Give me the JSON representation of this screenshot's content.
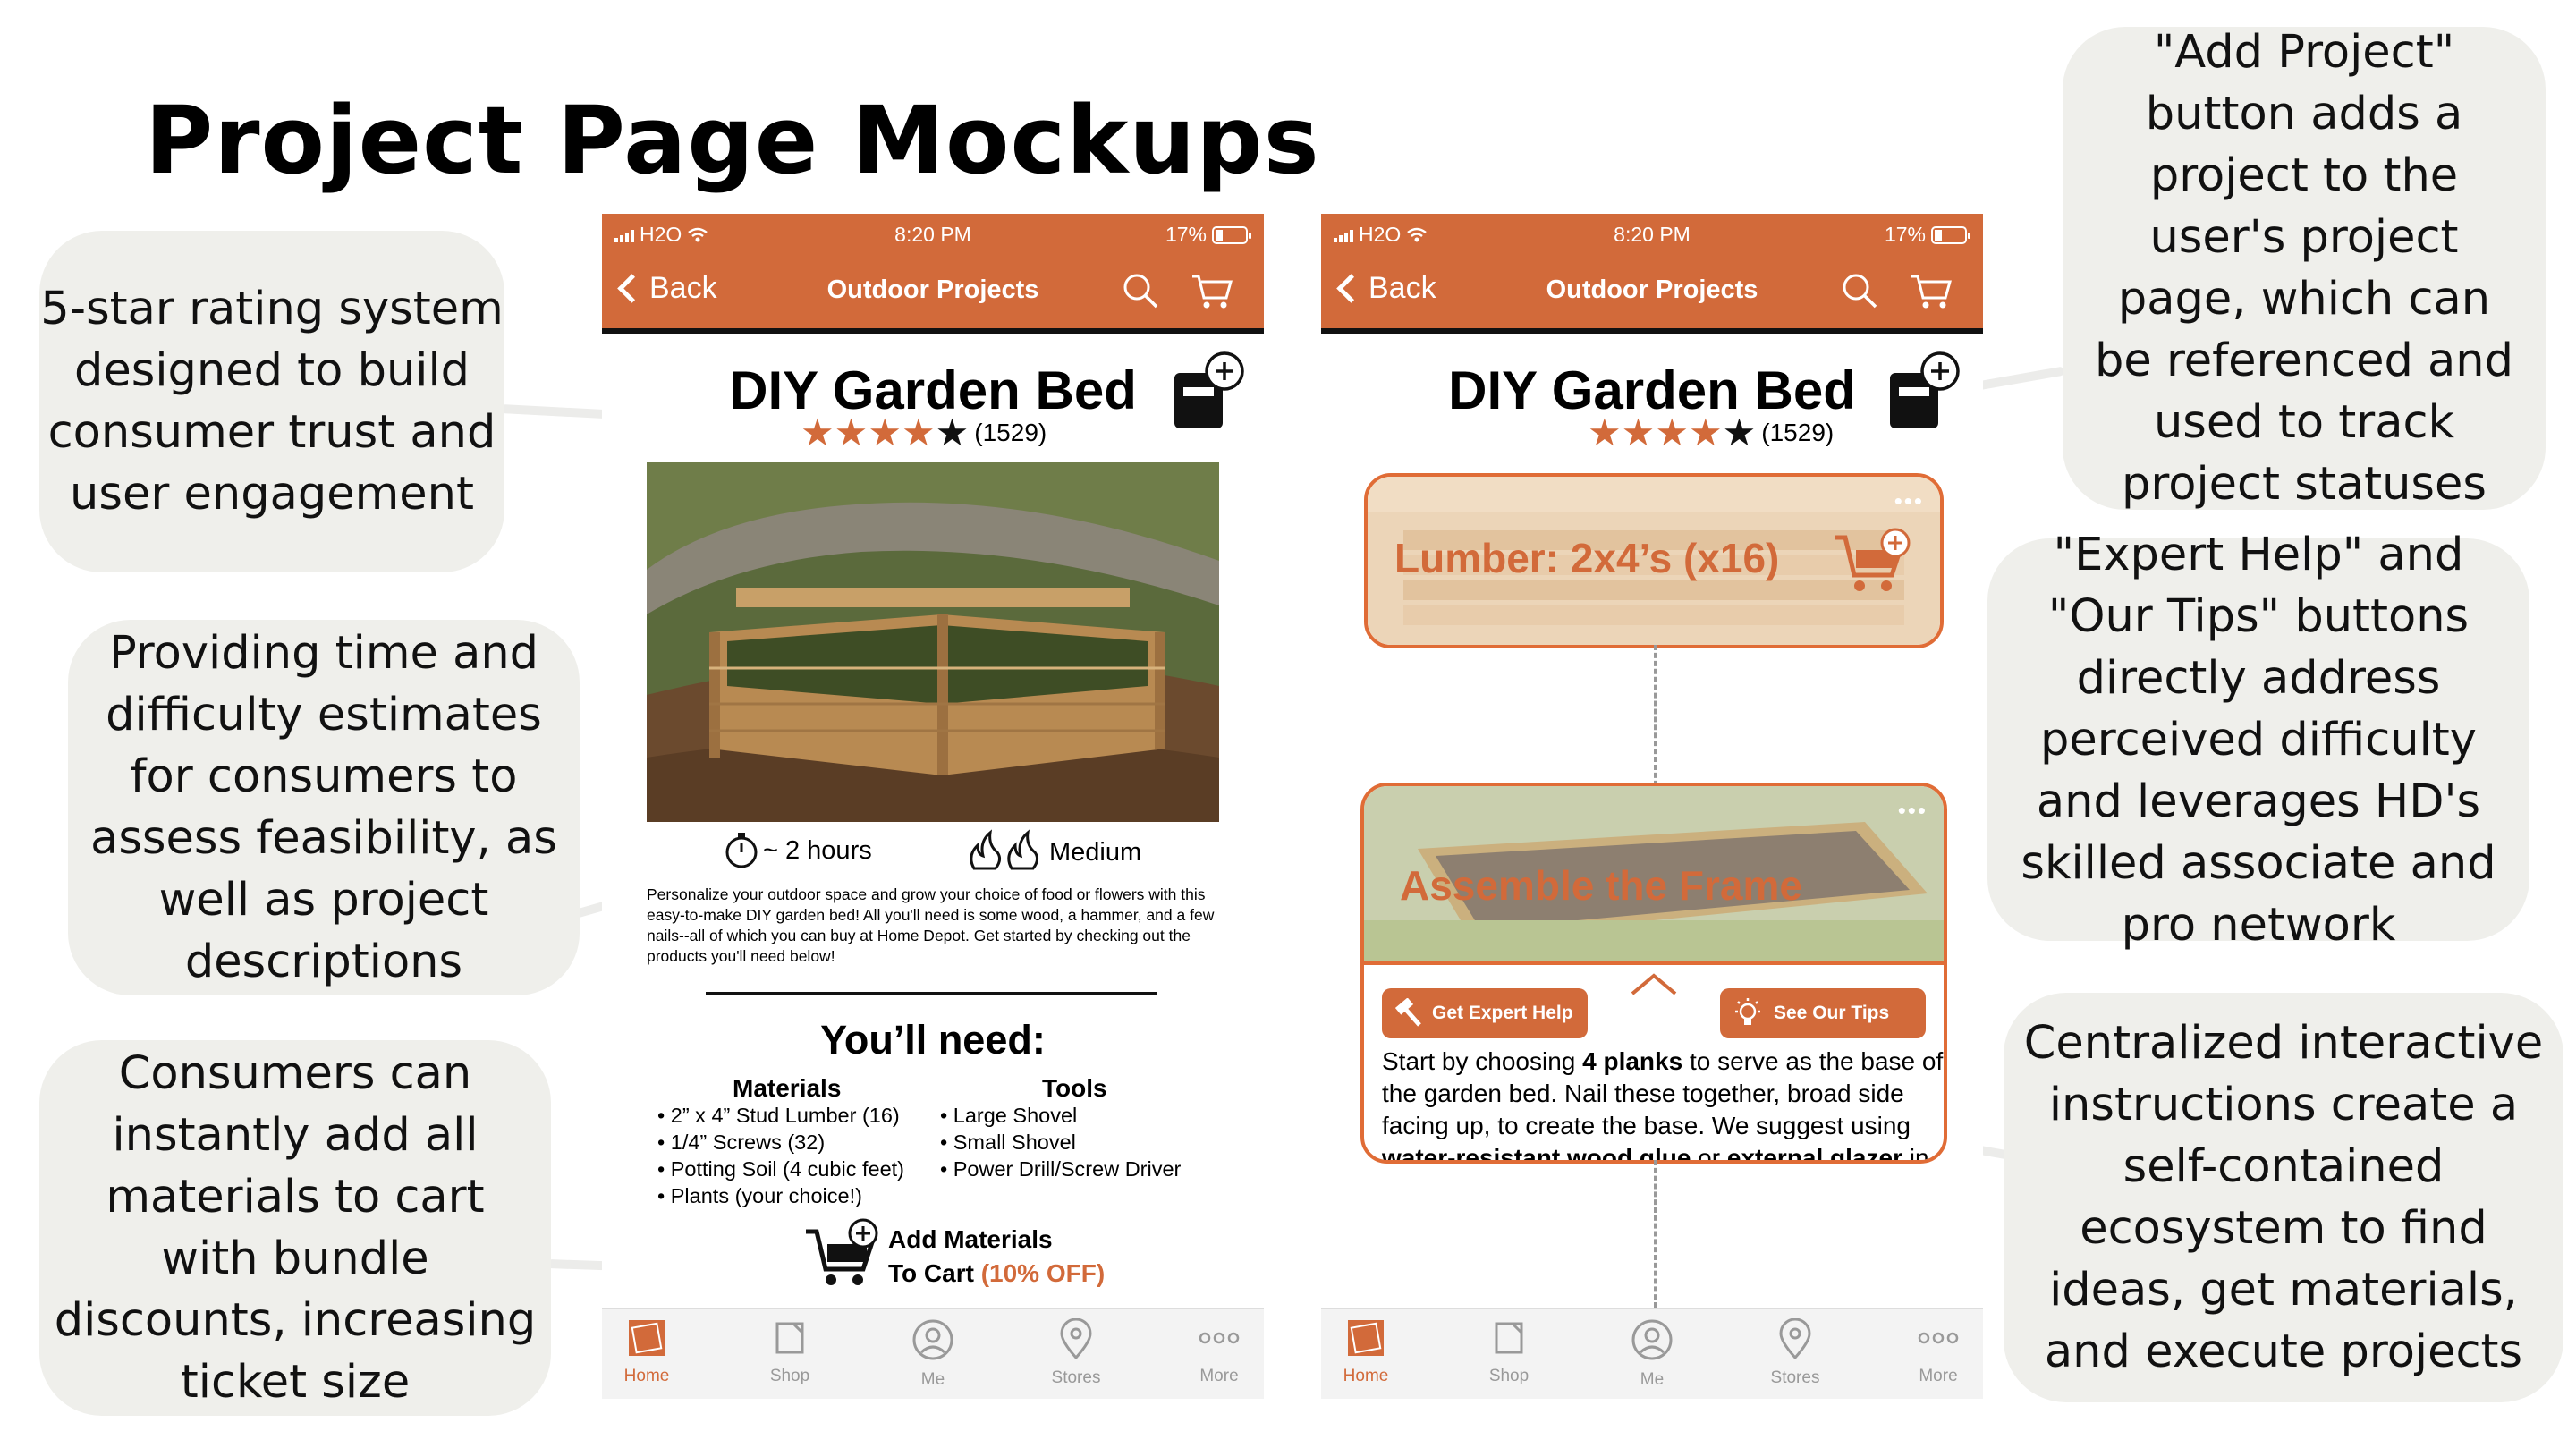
{
  "slide": {
    "title": "Project Page Mockups"
  },
  "callouts": {
    "rating": "5-star rating system designed to build consumer trust and user engagement",
    "estimates": "Providing time and difficulty estimates for consumers to assess feasibility, as well as project descriptions",
    "bundle": "Consumers can instantly add all materials to cart with bundle discounts, increasing ticket size",
    "add_project": "\"Add Project\" button adds a project to the user's project page, which can be referenced and used to track project statuses",
    "expert_help": "\"Expert Help\" and \"Our Tips\" buttons directly address perceived difficulty and leverages HD's skilled associate and pro network",
    "ecosystem": "Centralized interactive instructions create a self-contained ecosystem to find ideas, get materials, and execute projects"
  },
  "status_bar": {
    "carrier": "H2O",
    "time": "8:20 PM",
    "battery": "17%"
  },
  "nav": {
    "back_label": "Back",
    "title": "Outdoor Projects"
  },
  "project": {
    "title": "DIY Garden Bed",
    "rating_count": "(1529)",
    "rating_value": 4,
    "rating_max": 5,
    "time_estimate": "~ 2 hours",
    "difficulty": "Medium",
    "description": "Personalize your outdoor space and grow your choice of food or flowers with this easy-to-make DIY garden bed! All you'll need is some wood, a hammer, and a few nails--all of which you can buy at Home Depot. Get started by checking out the products you'll need below!",
    "youll_need": "You’ll need:",
    "materials_heading": "Materials",
    "tools_heading": "Tools",
    "materials": [
      "• 2” x 4” Stud Lumber (16)",
      "• 1/4” Screws (32)",
      "• Potting Soil (4 cubic feet)",
      "• Plants (your choice!)"
    ],
    "tools": [
      "• Large Shovel",
      "• Small Shovel",
      "• Power Drill/Screw Driver"
    ],
    "add_materials": "Add Materials",
    "to_cart": "To Cart",
    "discount": "(10% OFF)"
  },
  "steps": {
    "lumber_label": "Lumber: 2x4’s (x16)",
    "frame_label": "Assemble the Frame",
    "dots": "•••",
    "expert_btn": "Get Expert Help",
    "tips_btn": "See Our Tips",
    "instructions": [
      {
        "text": "Start by choosing ",
        "bold": false
      },
      {
        "text": "4 planks",
        "bold": true
      },
      {
        "text": " to serve as the base of the garden bed. Nail these together, broad side facing up, to create the base. We suggest using ",
        "bold": false
      },
      {
        "text": "water-resistant wood glue",
        "bold": true
      },
      {
        "text": " or ",
        "bold": false
      },
      {
        "text": "external glazer",
        "bold": true
      },
      {
        "text": " in the seams to prevent exc...",
        "bold": false
      }
    ]
  },
  "tabs": [
    "Home",
    "Shop",
    "Me",
    "Stores",
    "More"
  ],
  "colors": {
    "accent": "#d26a3a",
    "card_border": "#e06c36",
    "bubble": "#efefeb"
  }
}
